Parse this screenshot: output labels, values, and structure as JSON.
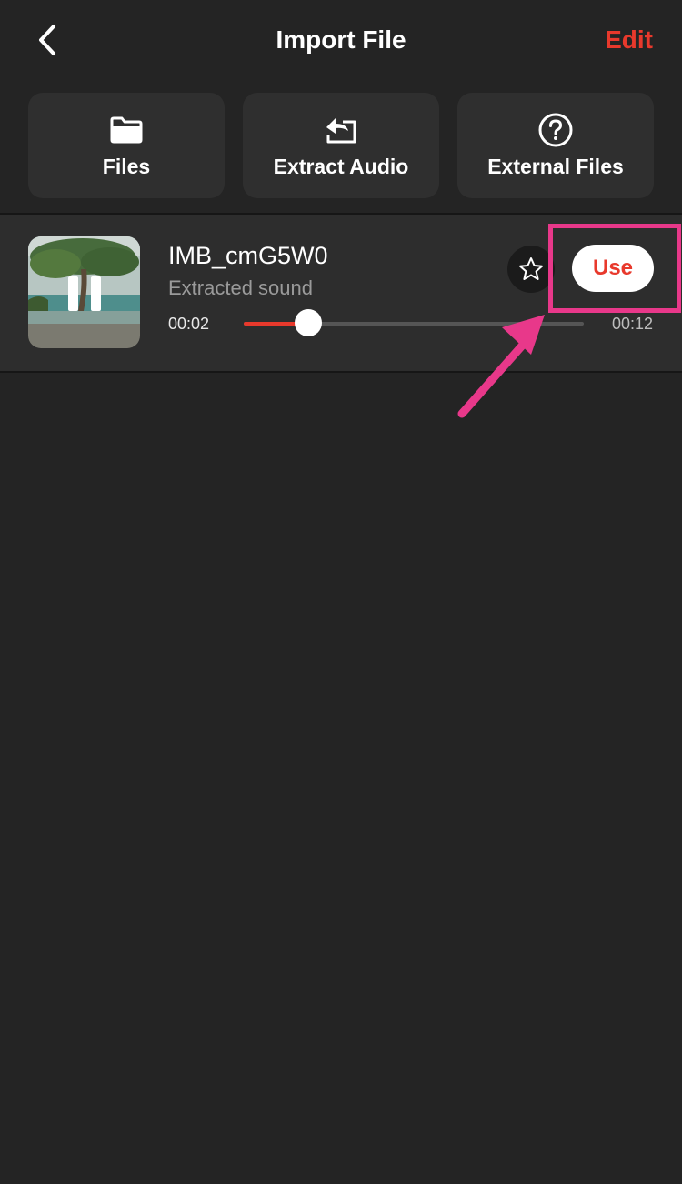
{
  "header": {
    "title": "Import File",
    "edit_label": "Edit"
  },
  "tiles": [
    {
      "label": "Files",
      "icon": "folder-icon"
    },
    {
      "label": "Extract Audio",
      "icon": "reply-arrow-icon"
    },
    {
      "label": "External Files",
      "icon": "question-circle-icon"
    }
  ],
  "track": {
    "name": "IMB_cmG5W0",
    "subtitle": "Extracted sound",
    "current_time": "00:02",
    "total_time": "00:12",
    "progress": 0.19,
    "use_label": "Use",
    "is_playing": true
  },
  "colors": {
    "accent": "#e8392c",
    "annotation": "#e8388a",
    "background": "#242424"
  }
}
